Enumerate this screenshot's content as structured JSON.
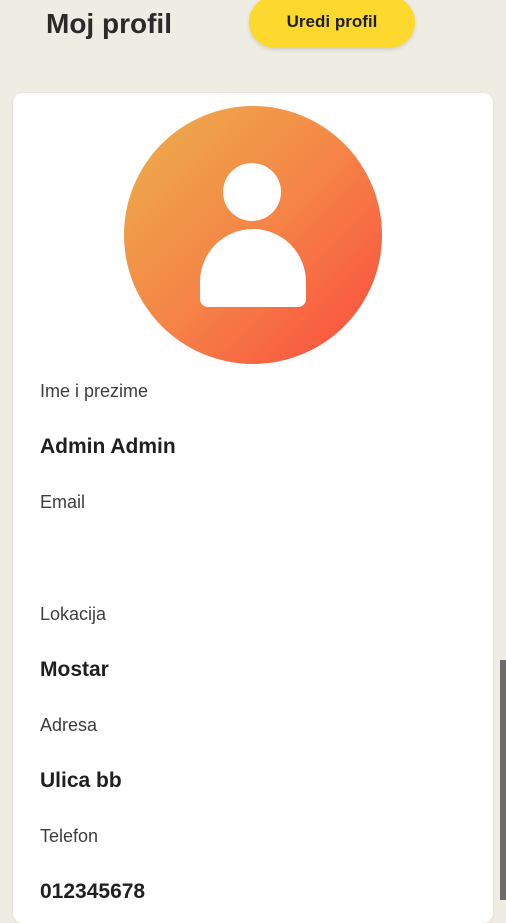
{
  "header": {
    "title": "Moj profil",
    "edit_button_label": "Uredi profil"
  },
  "profile": {
    "avatar_icon": "user-silhouette-icon",
    "avatar_gradient": [
      "#ebb04a",
      "#f58547",
      "#fb4a3e"
    ],
    "fields": [
      {
        "label": "Ime i prezime",
        "value": "Admin Admin"
      },
      {
        "label": "Email",
        "value": ""
      },
      {
        "label": "Lokacija",
        "value": "Mostar"
      },
      {
        "label": "Adresa",
        "value": "Ulica bb"
      },
      {
        "label": "Telefon",
        "value": "012345678"
      }
    ]
  },
  "colors": {
    "background": "#efece4",
    "accent": "#fcd92c",
    "card": "#ffffff"
  }
}
